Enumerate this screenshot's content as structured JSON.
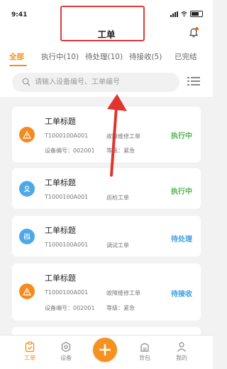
{
  "status_bar": {
    "time": "9:41"
  },
  "header": {
    "title": "工单"
  },
  "tabs": [
    {
      "label": "全部",
      "active": true
    },
    {
      "label": "执行中(10)",
      "active": false
    },
    {
      "label": "待处理(10)",
      "active": false
    },
    {
      "label": "待接收(5)",
      "active": false
    },
    {
      "label": "已完结",
      "active": false
    }
  ],
  "search": {
    "placeholder": "请输入设备编号、工单编号"
  },
  "cards": [
    {
      "title": "工单标题",
      "code": "T1000100A001",
      "type": "故障维修工单",
      "device": "设备编号：002001",
      "level": "等级：紧急",
      "status": "执行中",
      "status_color": "#52b34d",
      "icon": "warning-icon"
    },
    {
      "title": "工单标题",
      "code": "T1000100A001",
      "type": "巡检工单",
      "status": "执行中",
      "status_color": "#52b34d",
      "icon": "inspection-icon"
    },
    {
      "title": "工单标题",
      "code": "T1000100A001",
      "type": "调试工单",
      "status": "待处理",
      "status_color": "#3d9fe0",
      "icon": "debug-sliders-icon"
    },
    {
      "title": "工单标题",
      "code": "T1000100A001",
      "type": "故障维修工单",
      "device": "设备编号：002001",
      "level": "等级：紧急",
      "status": "待接收",
      "status_color": "#3d9fe0",
      "icon": "warning-icon"
    }
  ],
  "bottom_nav": [
    {
      "label": "工单",
      "active": true
    },
    {
      "label": "设备",
      "active": false
    },
    {
      "label": "+",
      "active": false
    },
    {
      "label": "背包",
      "active": false
    },
    {
      "label": "我的",
      "active": false
    }
  ],
  "colors": {
    "accent": "#f2901a",
    "highlight": "#e03a3a",
    "green": "#52b34d",
    "blue": "#3d9fe0"
  }
}
